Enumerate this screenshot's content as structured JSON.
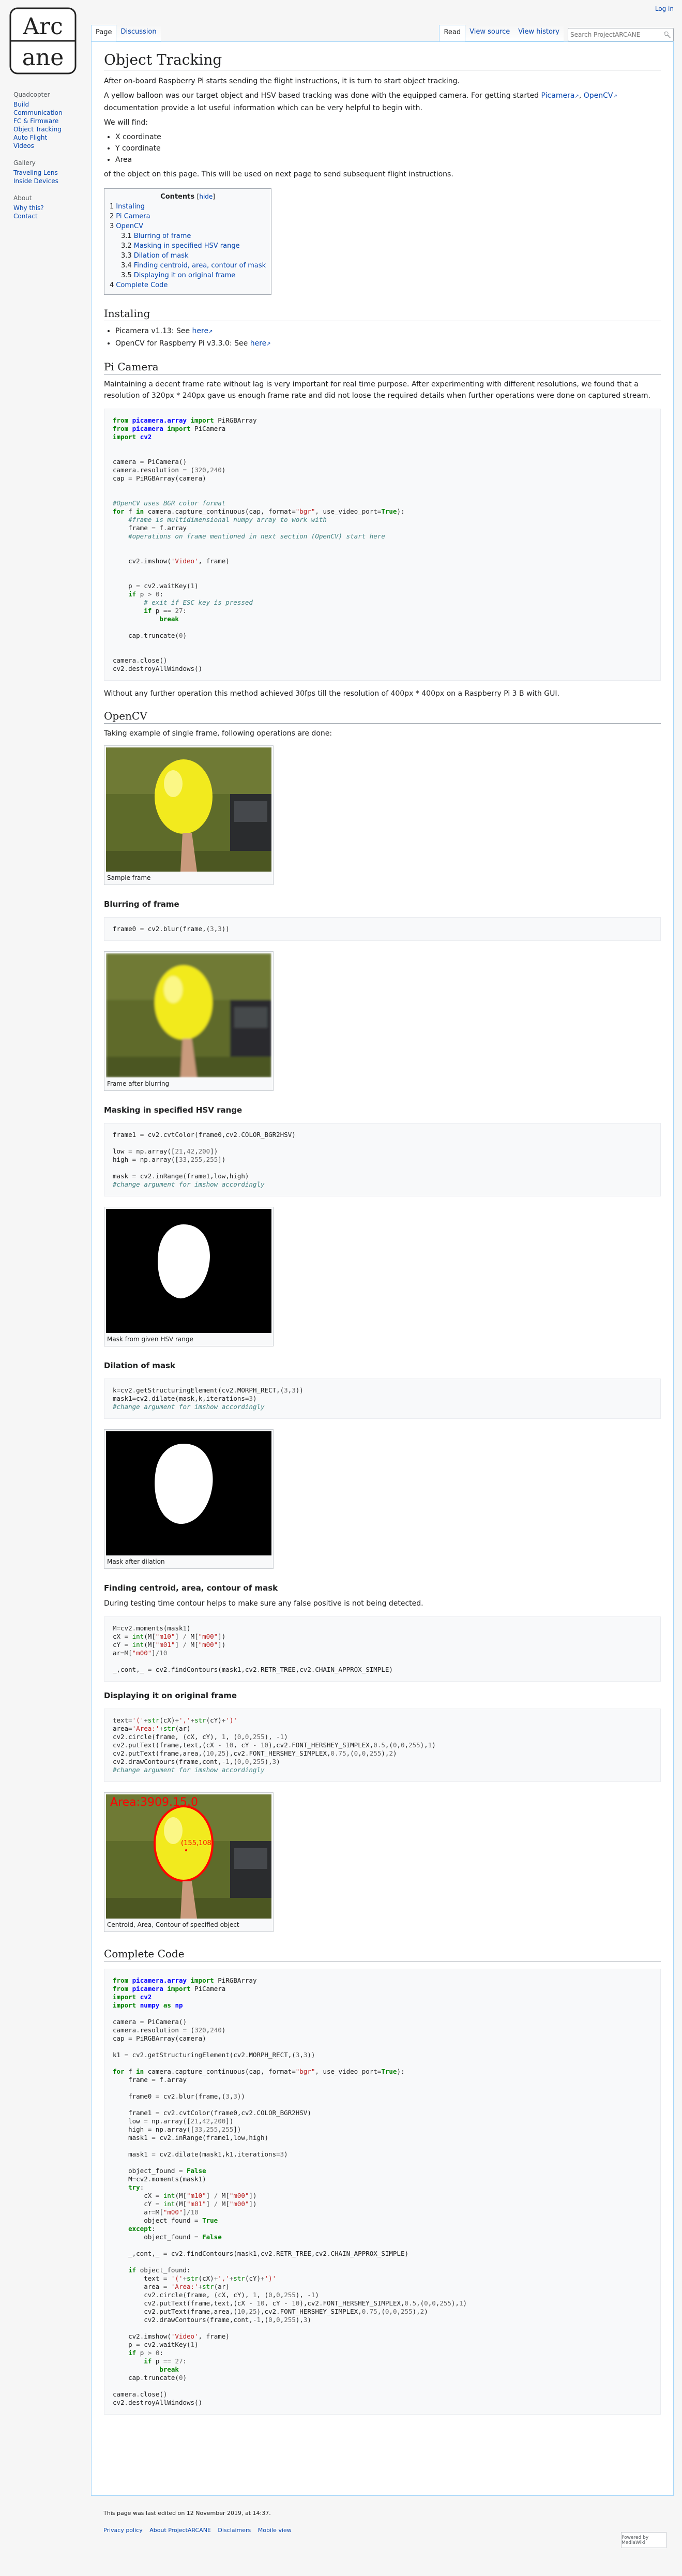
{
  "header": {
    "login": "Log in",
    "tabs_left": [
      "Page",
      "Discussion"
    ],
    "tabs_right": [
      "Read",
      "View source",
      "View history"
    ],
    "search_placeholder": "Search ProjectARCANE"
  },
  "logo": {
    "line1": "Arc",
    "line2": "ane"
  },
  "sidebar": {
    "main": {
      "title": "Quadcopter",
      "items": [
        "Build",
        "Communication",
        "FC & Firmware",
        "Object Tracking",
        "Auto Flight",
        "Videos"
      ]
    },
    "gallery": {
      "title": "Gallery",
      "items": [
        "Traveling Lens",
        "Inside Devices"
      ]
    },
    "about": {
      "title": "About",
      "items": [
        "Why this?",
        "Contact"
      ]
    }
  },
  "page": {
    "title": "Object Tracking",
    "intro1": "After on-board Raspberry Pi starts sending the flight instructions, it is turn to start object tracking.",
    "intro2a": "A yellow balloon was our target object and HSV based tracking was done with the equipped camera. For getting started ",
    "link_picamera": "Picamera",
    "link_opencv": "OpenCV",
    "intro2b": " documentation provide a lot useful information which can be very helpful to begin with.",
    "will_find": "We will find:",
    "find_items": [
      "X coordinate",
      "Y coordinate",
      "Area"
    ],
    "find_after": "of the object on this page. This will be used on next page to send subsequent flight instructions.",
    "toc": {
      "title": "Contents",
      "hide": "hide",
      "items": [
        {
          "n": "1",
          "t": "Instaling",
          "sub": false
        },
        {
          "n": "2",
          "t": "Pi Camera",
          "sub": false
        },
        {
          "n": "3",
          "t": "OpenCV",
          "sub": false
        },
        {
          "n": "3.1",
          "t": "Blurring of frame",
          "sub": true
        },
        {
          "n": "3.2",
          "t": "Masking in specified HSV range",
          "sub": true
        },
        {
          "n": "3.3",
          "t": "Dilation of mask",
          "sub": true
        },
        {
          "n": "3.4",
          "t": "Finding centroid, area, contour of mask",
          "sub": true
        },
        {
          "n": "3.5",
          "t": "Displaying it on original frame",
          "sub": true
        },
        {
          "n": "4",
          "t": "Complete Code",
          "sub": false
        }
      ]
    },
    "h_install": "Instaling",
    "install_items": [
      {
        "t": "Picamera v1.13: See ",
        "l": "here"
      },
      {
        "t": "OpenCV for Raspberry Pi v3.3.0: See ",
        "l": "here"
      }
    ],
    "h_picam": "Pi Camera",
    "picam_p": "Maintaining a decent frame rate without lag is very important for real time purpose. After experimenting with different resolutions, we found that a resolution of 320px * 240px gave us enough frame rate and did not loose the required details when further operations were done on captured stream.",
    "picam_after": "Without any further operation this method achieved 30fps till the resolution of 400px * 400px on a Raspberry Pi 3 B with GUI.",
    "h_opencv": "OpenCV",
    "opencv_p": "Taking example of single frame, following operations are done:",
    "cap_sample": "Sample frame",
    "h_blur": "Blurring of frame",
    "cap_blur": "Frame after blurring",
    "h_mask": "Masking in specified HSV range",
    "cap_mask": "Mask from given HSV range",
    "h_dil": "Dilation of mask",
    "cap_dil": "Mask after dilation",
    "h_cent": "Finding centroid, area, contour of mask",
    "cent_p": "During testing time contour helps to make sure any false positive is not being detected.",
    "h_disp": "Displaying it on original frame",
    "overlay_area": "Area:3909.15.0",
    "overlay_coord": "(155,108)",
    "cap_disp": "Centroid, Area, Contour of specified object",
    "h_complete": "Complete Code"
  },
  "footer": {
    "edited": "This page was last edited on 12 November 2019, at 14:37.",
    "links": [
      "Privacy policy",
      "About ProjectARCANE",
      "Disclaimers",
      "Mobile view"
    ],
    "powered": "Powered by MediaWiki"
  }
}
